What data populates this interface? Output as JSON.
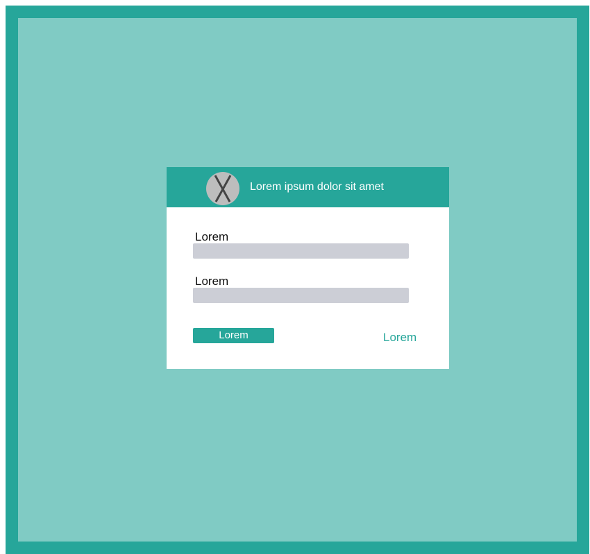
{
  "colors": {
    "frame_border": "#26a69a",
    "frame_background": "#80cbc4",
    "accent": "#26a69a",
    "dialog_background": "#ffffff",
    "input_background": "#ccced6",
    "close_circle": "#bdbdbd"
  },
  "dialog": {
    "header": {
      "close_icon": "close-x-icon",
      "title": "Lorem ipsum dolor sit amet"
    },
    "fields": [
      {
        "label": "Lorem",
        "value": "",
        "placeholder": ""
      },
      {
        "label": "Lorem",
        "value": "",
        "placeholder": ""
      }
    ],
    "submit_label": "Lorem",
    "link_label": "Lorem"
  }
}
